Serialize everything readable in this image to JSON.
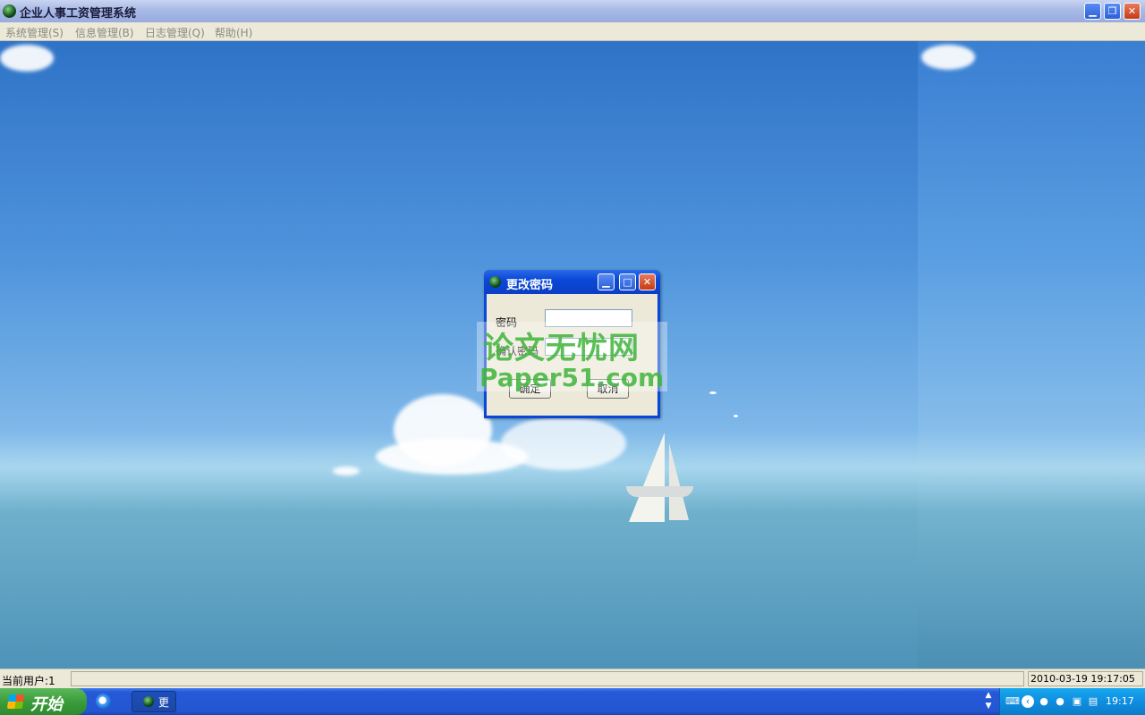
{
  "window": {
    "title": "企业人事工资管理系统",
    "minimize_glyph": "▁",
    "maximize_glyph": "❐",
    "close_glyph": "✕"
  },
  "menu": {
    "items": [
      {
        "label": "系统管理(S)"
      },
      {
        "label": "信息管理(B)"
      },
      {
        "label": "日志管理(Q)"
      },
      {
        "label": "帮助(H)"
      }
    ]
  },
  "dialog": {
    "title": "更改密码",
    "password_label": "密码",
    "confirm_label": "确认密码",
    "password_value": "",
    "confirm_value": "",
    "ok_label": "确定",
    "cancel_label": "取消"
  },
  "watermark": {
    "line1": "论文无忧网",
    "line2": "Paper51.com"
  },
  "statusbar": {
    "current_user": "当前用户:1",
    "datetime": "2010-03-19 19:17:05"
  },
  "taskbar": {
    "start_label": "开始",
    "task_label": "更",
    "clock": "19:17",
    "colors": {
      "taskbar": "#2456d2",
      "start": "#3a9d3a",
      "tray": "#0f8ee0"
    }
  }
}
